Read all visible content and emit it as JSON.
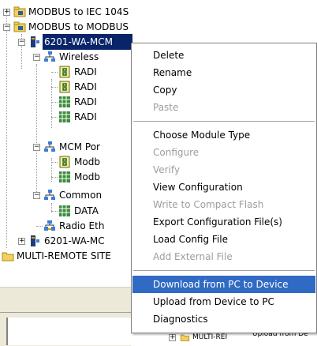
{
  "tree": {
    "items": [
      {
        "label": "MODBUS to IEC 104S"
      },
      {
        "label": "MODBUS to MODBUS"
      },
      {
        "label": "6201-WA-MCM"
      },
      {
        "label": "Wireless"
      },
      {
        "label": "RADI"
      },
      {
        "label": "RADI"
      },
      {
        "label": "RADI"
      },
      {
        "label": "RADI"
      },
      {
        "label": "MCM Por"
      },
      {
        "label": "Modb"
      },
      {
        "label": "Modb"
      },
      {
        "label": "Common"
      },
      {
        "label": "DATA"
      },
      {
        "label": "Radio Eth"
      },
      {
        "label": "6201-WA-MC"
      },
      {
        "label": "MULTI-REMOTE SITE"
      }
    ],
    "expander_collapsed": "+",
    "expander_expanded": "−"
  },
  "context_menu": {
    "items": [
      {
        "label": "Delete",
        "enabled": true
      },
      {
        "label": "Rename",
        "enabled": true
      },
      {
        "label": "Copy",
        "enabled": true
      },
      {
        "label": "Paste",
        "enabled": false
      },
      {
        "label": "Choose Module Type",
        "enabled": true
      },
      {
        "label": "Configure",
        "enabled": false
      },
      {
        "label": "Verify",
        "enabled": false
      },
      {
        "label": "View Configuration",
        "enabled": true
      },
      {
        "label": "Write to Compact Flash",
        "enabled": false
      },
      {
        "label": "Export Configuration File(s)",
        "enabled": true
      },
      {
        "label": "Load Config File",
        "enabled": true
      },
      {
        "label": "Add External File",
        "enabled": false
      },
      {
        "label": "Download from PC to Device",
        "enabled": true,
        "highlighted": true
      },
      {
        "label": "Upload from Device to PC",
        "enabled": true
      },
      {
        "label": "Diagnostics",
        "enabled": true
      }
    ]
  },
  "background_ghost": {
    "node_label": "MULTI-REI",
    "menu_snippet": "Upload from De"
  },
  "colors": {
    "selection": "#0a246a",
    "menu_highlight": "#316ac5",
    "disabled_text": "#9d9d9d",
    "folder": "#f2d05a"
  }
}
